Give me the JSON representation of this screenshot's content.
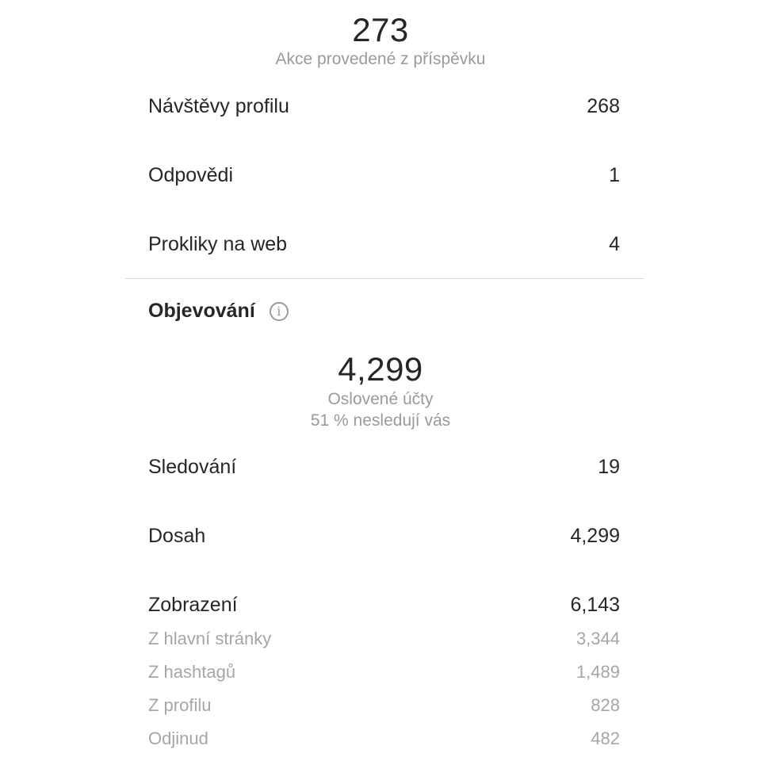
{
  "post_actions": {
    "total": "273",
    "caption": "Akce provedené z příspěvku",
    "rows": [
      {
        "label": "Návštěvy profilu",
        "value": "268"
      },
      {
        "label": "Odpovědi",
        "value": "1"
      },
      {
        "label": "Prokliky na web",
        "value": "4"
      }
    ]
  },
  "discovery": {
    "title": "Objevování",
    "info_icon": "info-icon",
    "total": "4,299",
    "caption": "Oslovené účty",
    "subcaption": "51 % nesledují vás",
    "rows": [
      {
        "label": "Sledování",
        "value": "19"
      },
      {
        "label": "Dosah",
        "value": "4,299"
      },
      {
        "label": "Zobrazení",
        "value": "6,143"
      }
    ],
    "impression_sources": [
      {
        "label": "Z hlavní stránky",
        "value": "3,344"
      },
      {
        "label": "Z hashtagů",
        "value": "1,489"
      },
      {
        "label": "Z profilu",
        "value": "828"
      },
      {
        "label": "Odjinud",
        "value": "482"
      }
    ]
  }
}
